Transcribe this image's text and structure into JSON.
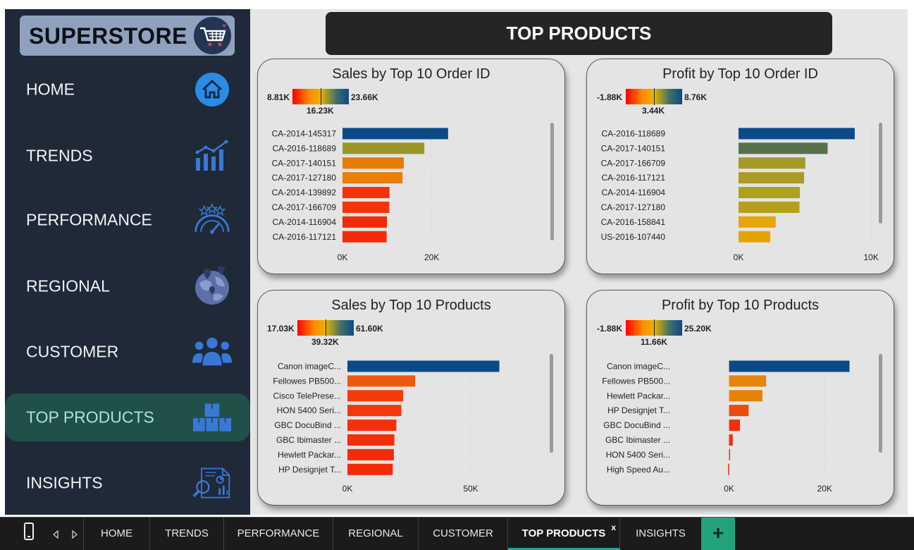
{
  "brand": {
    "name": "SUPERSTORE",
    "logo_icon": "shopping-cart-icon"
  },
  "nav": [
    {
      "label": "HOME",
      "icon": "home-icon",
      "active": false
    },
    {
      "label": "TRENDS",
      "icon": "bar-trend-icon",
      "active": false
    },
    {
      "label": "PERFORMANCE",
      "icon": "speedometer-stars-icon",
      "active": false
    },
    {
      "label": "REGIONAL",
      "icon": "globe-pins-icon",
      "active": false
    },
    {
      "label": "CUSTOMER",
      "icon": "users-group-icon",
      "active": false
    },
    {
      "label": "TOP PRODUCTS",
      "icon": "boxes-icon",
      "active": true
    },
    {
      "label": "INSIGHTS",
      "icon": "report-magnifier-icon",
      "active": false
    }
  ],
  "page_title": "TOP PRODUCTS",
  "colors": {
    "sidebar": "#1f2937",
    "active_nav": "#1f5049",
    "accent": "#22a39f",
    "bar_top": "#0c4a87"
  },
  "chart_data": [
    {
      "type": "bar",
      "orientation": "horizontal",
      "title": "Sales by Top 10 Order ID",
      "legend": {
        "min": "8.81K",
        "mid": "16.23K",
        "max": "23.66K",
        "mid_fraction": 0.5
      },
      "categories": [
        "CA-2014-145317",
        "CA-2016-118689",
        "CA-2017-140151",
        "CA-2017-127180",
        "CA-2014-139892",
        "CA-2017-166709",
        "CA-2014-116904",
        "CA-2016-117121"
      ],
      "values": [
        23661,
        18337,
        13743,
        13462,
        10540,
        10480,
        9958,
        9892
      ],
      "colors": [
        "#0b4a87",
        "#9b9629",
        "#e77c05",
        "#ea7e04",
        "#f3320a",
        "#f53508",
        "#f52a05",
        "#f52a05"
      ],
      "xlim": [
        0,
        30000
      ],
      "xticks": [
        {
          "value": 0,
          "label": "0K"
        },
        {
          "value": 20000,
          "label": "20K"
        }
      ]
    },
    {
      "type": "bar",
      "orientation": "horizontal",
      "title": "Profit by Top 10 Order ID",
      "legend": {
        "min": "-1.88K",
        "mid": "3.44K",
        "max": "8.76K",
        "mid_fraction": 0.5
      },
      "categories": [
        "CA-2016-118689",
        "CA-2017-140151",
        "CA-2017-166709",
        "CA-2016-117121",
        "CA-2014-116904",
        "CA-2017-127180",
        "CA-2016-158841",
        "US-2016-107440"
      ],
      "values": [
        8762,
        6720,
        5040,
        4946,
        4630,
        4596,
        2800,
        2400
      ],
      "colors": [
        "#0b4a87",
        "#56704f",
        "#a49a27",
        "#a99b25",
        "#aea11d",
        "#b5a01a",
        "#e6a604",
        "#e6a306"
      ],
      "xlim": [
        0,
        11000
      ],
      "xticks": [
        {
          "value": 0,
          "label": "0K"
        },
        {
          "value": 10000,
          "label": "10K"
        }
      ]
    },
    {
      "type": "bar",
      "orientation": "horizontal",
      "title": "Sales by Top 10 Products",
      "legend": {
        "min": "17.03K",
        "mid": "39.32K",
        "max": "61.60K",
        "mid_fraction": 0.5
      },
      "categories": [
        "Canon imageC...",
        "Fellowes PB500...",
        "Cisco TelePrese...",
        "HON 5400 Seri...",
        "GBC DocuBind ...",
        "GBC Ibimaster ...",
        "Hewlett Packar...",
        "HP Designjet T..."
      ],
      "values": [
        61600,
        27450,
        22640,
        21870,
        19820,
        19020,
        18840,
        18370
      ],
      "colors": [
        "#0b4a87",
        "#ef5a0a",
        "#f53a0a",
        "#f5380a",
        "#f5300a",
        "#f52c08",
        "#f52b08",
        "#f52a08"
      ],
      "xlim": [
        0,
        80000
      ],
      "xticks": [
        {
          "value": 0,
          "label": "0K"
        },
        {
          "value": 50000,
          "label": "50K"
        }
      ]
    },
    {
      "type": "bar",
      "orientation": "horizontal",
      "title": "Profit by Top 10 Products",
      "legend": {
        "min": "-1.88K",
        "mid": "11.66K",
        "max": "25.20K",
        "mid_fraction": 0.5
      },
      "categories": [
        "Canon imageC...",
        "Fellowes PB500...",
        "Hewlett Packar...",
        "HP Designjet T...",
        "GBC DocuBind ...",
        "GBC Ibimaster ...",
        "HON 5400 Seri...",
        "High Speed Au..."
      ],
      "values": [
        25200,
        7750,
        6980,
        4090,
        2280,
        760,
        0,
        -200
      ],
      "colors": [
        "#0b4a87",
        "#e68507",
        "#e68206",
        "#ea4d09",
        "#f52f09",
        "#f52a08",
        "#f52a08",
        "#f52208"
      ],
      "xlim": [
        -2000,
        30000
      ],
      "xticks": [
        {
          "value": 0,
          "label": "0K"
        },
        {
          "value": 20000,
          "label": "20K"
        }
      ]
    }
  ],
  "tabbar": {
    "device_icon": "phone-icon",
    "prev_icon": "triangle-left-icon",
    "next_icon": "triangle-right-icon",
    "tabs": [
      {
        "label": "HOME",
        "active": false
      },
      {
        "label": "TRENDS",
        "active": false
      },
      {
        "label": "PERFORMANCE",
        "active": false
      },
      {
        "label": "REGIONAL",
        "active": false
      },
      {
        "label": "CUSTOMER",
        "active": false
      },
      {
        "label": "TOP PRODUCTS",
        "active": true
      },
      {
        "label": "INSIGHTS",
        "active": false
      }
    ],
    "close_glyph": "x",
    "add_glyph": "+"
  }
}
